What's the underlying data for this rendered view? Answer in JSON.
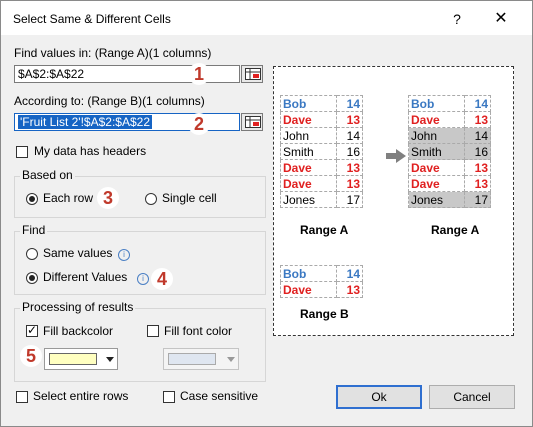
{
  "window": {
    "title": "Select Same & Different Cells",
    "help": "?",
    "close": "✕"
  },
  "find_in": {
    "label": "Find values in: (Range A)(1 columns)",
    "value": "$A$2:$A$22"
  },
  "according": {
    "label": "According to: (Range B)(1 columns)",
    "value": "'Fruit List 2'!$A$2:$A$22"
  },
  "headers": {
    "label": "My data has headers",
    "checked": false
  },
  "based_on": {
    "title": "Based on",
    "each_row": "Each row",
    "single_cell": "Single cell",
    "selected": "each_row"
  },
  "find": {
    "title": "Find",
    "same": "Same values",
    "different": "Different Values",
    "selected": "different"
  },
  "processing": {
    "title": "Processing of results",
    "fill_back": "Fill backcolor",
    "fill_back_checked": true,
    "fill_font": "Fill font color",
    "fill_font_checked": false,
    "back_color": "#ffffc0",
    "font_color": "#dfe6f0"
  },
  "bottom": {
    "entire_rows": "Select entire rows",
    "case": "Case sensitive",
    "ok": "Ok",
    "cancel": "Cancel"
  },
  "steps": [
    "1",
    "2",
    "3",
    "4",
    "5"
  ],
  "preview": {
    "range_a_label": "Range A",
    "range_a_result_label": "Range A",
    "range_b_label": "Range B",
    "range_a": [
      {
        "name": "Bob",
        "value": "14",
        "style": "blue"
      },
      {
        "name": "Dave",
        "value": "13",
        "style": "red"
      },
      {
        "name": "John",
        "value": "14",
        "style": "plain"
      },
      {
        "name": "Smith",
        "value": "16",
        "style": "plain"
      },
      {
        "name": "Dave",
        "value": "13",
        "style": "red"
      },
      {
        "name": "Dave",
        "value": "13",
        "style": "red"
      },
      {
        "name": "Jones",
        "value": "17",
        "style": "plain"
      }
    ],
    "range_b": [
      {
        "name": "Bob",
        "value": "14",
        "style": "blue"
      },
      {
        "name": "Dave",
        "value": "13",
        "style": "red"
      }
    ]
  },
  "colors": {
    "accent_blue": "#3a78c2",
    "accent_red": "#e02020",
    "selection": "#1664c4",
    "highlight": "#c8c8c8"
  }
}
